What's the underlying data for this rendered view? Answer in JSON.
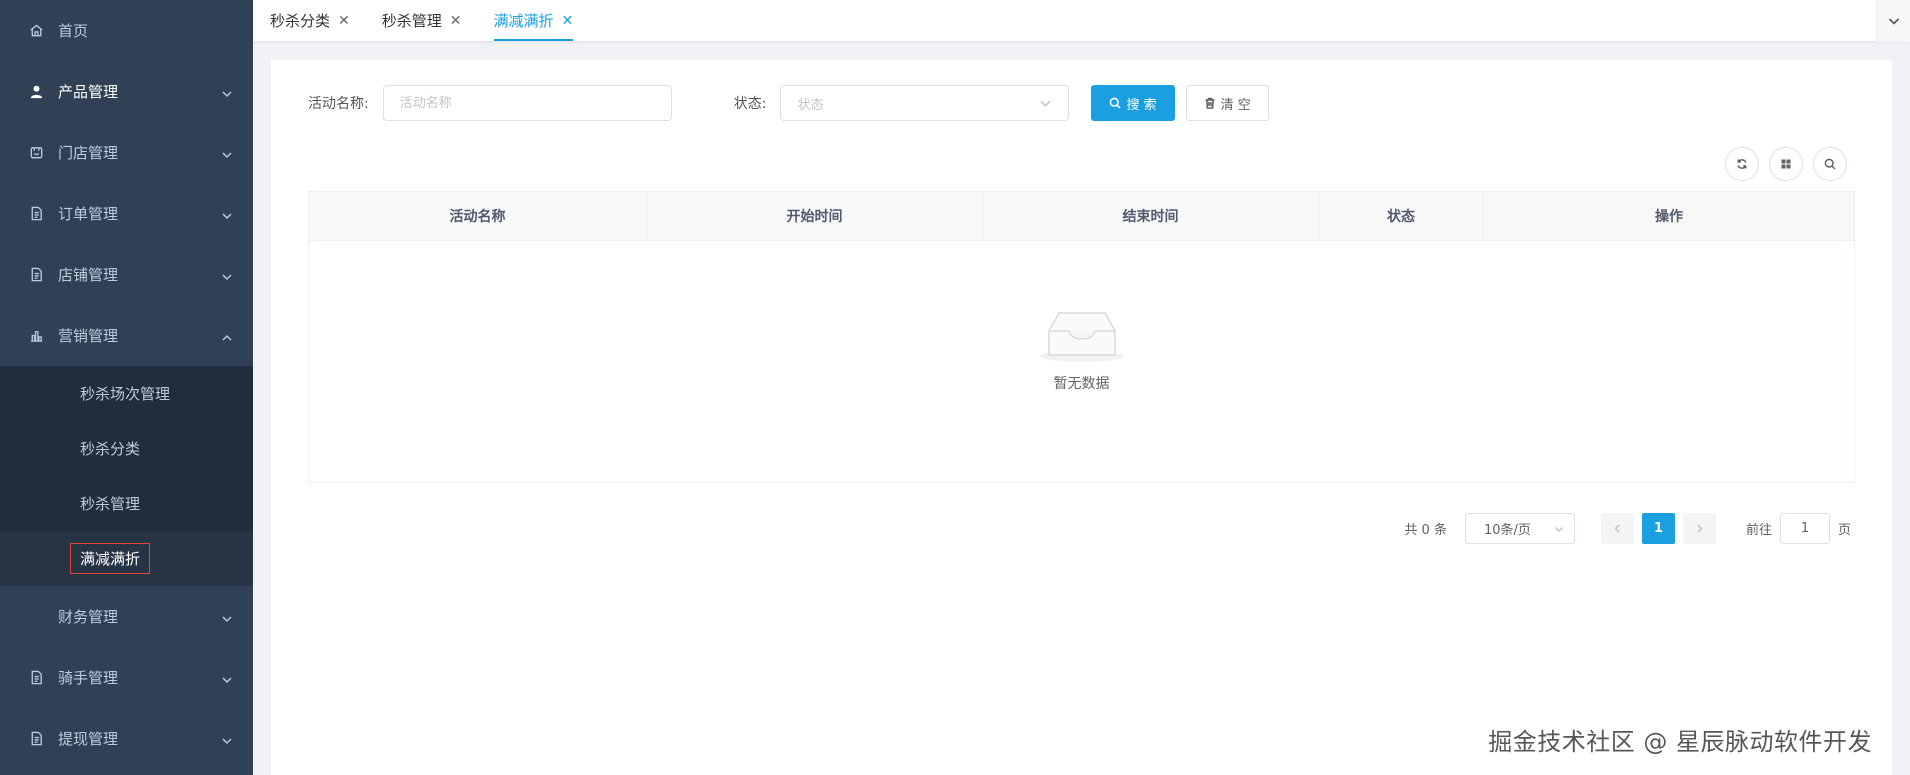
{
  "sidebar": {
    "items": [
      {
        "label": "首页",
        "icon": "home-icon",
        "has_arrow": false
      },
      {
        "label": "产品管理",
        "icon": "user-icon",
        "has_arrow": true
      },
      {
        "label": "门店管理",
        "icon": "store-icon",
        "has_arrow": true
      },
      {
        "label": "订单管理",
        "icon": "document-icon",
        "has_arrow": true
      },
      {
        "label": "店铺管理",
        "icon": "document-icon",
        "has_arrow": true
      },
      {
        "label": "营销管理",
        "icon": "chart-icon",
        "has_arrow": true,
        "expanded": true
      }
    ],
    "marketing_sub": [
      {
        "label": "秒杀场次管理"
      },
      {
        "label": "秒杀分类"
      },
      {
        "label": "秒杀管理"
      },
      {
        "label": "满减满折",
        "active": true
      }
    ],
    "items_after": [
      {
        "label": "财务管理",
        "icon": "none",
        "has_arrow": true
      },
      {
        "label": "骑手管理",
        "icon": "document-icon",
        "has_arrow": true
      },
      {
        "label": "提现管理",
        "icon": "document-icon",
        "has_arrow": true
      }
    ]
  },
  "tabs": [
    {
      "label": "秒杀分类",
      "active": false
    },
    {
      "label": "秒杀管理",
      "active": false
    },
    {
      "label": "满减满折",
      "active": true
    }
  ],
  "filter": {
    "name_label": "活动名称:",
    "name_placeholder": "活动名称",
    "status_label": "状态:",
    "status_placeholder": "状态",
    "search_label": "搜 索",
    "clear_label": "清 空"
  },
  "table": {
    "columns": [
      "活动名称",
      "开始时间",
      "结束时间",
      "状态",
      "操作"
    ],
    "rows": [],
    "empty_text": "暂无数据"
  },
  "pagination": {
    "total_text": "共 0 条",
    "page_size": "10条/页",
    "current_page": "1",
    "jump_prefix": "前往",
    "jump_value": "1",
    "jump_suffix": "页"
  },
  "watermark": "掘金技术社区 @ 星辰脉动软件开发",
  "colors": {
    "sidebar_bg": "#304156",
    "submenu_bg": "#1f2d3d",
    "primary": "#1a9fe0",
    "active_outline": "#e0463a"
  }
}
